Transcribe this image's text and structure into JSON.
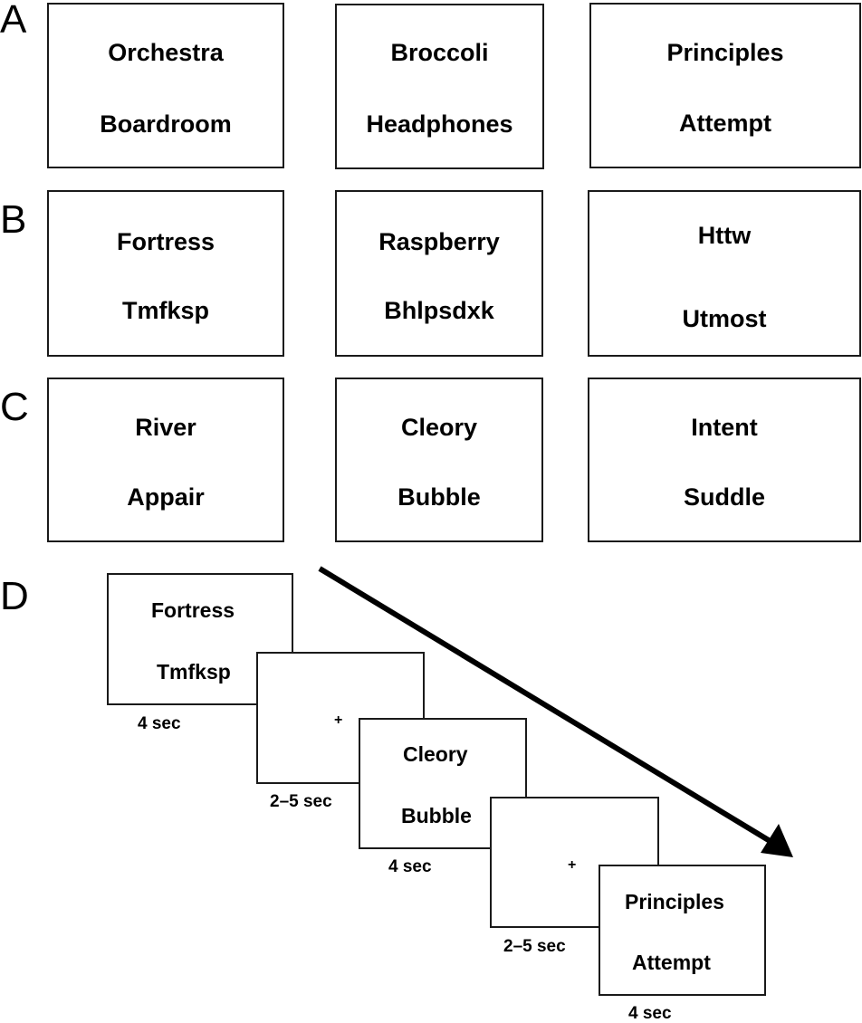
{
  "panels": {
    "A": {
      "letter": "A",
      "stimuli": [
        {
          "top": "Orchestra",
          "bottom": "Boardroom"
        },
        {
          "top": "Broccoli",
          "bottom": "Headphones"
        },
        {
          "top": "Principles",
          "bottom": "Attempt"
        }
      ]
    },
    "B": {
      "letter": "B",
      "stimuli": [
        {
          "top": "Fortress",
          "bottom": "Tmfksp"
        },
        {
          "top": "Raspberry",
          "bottom": "Bhlpsdxk"
        },
        {
          "top": "Httw",
          "bottom": "Utmost"
        }
      ]
    },
    "C": {
      "letter": "C",
      "stimuli": [
        {
          "top": "River",
          "bottom": "Appair"
        },
        {
          "top": "Cleory",
          "bottom": "Bubble"
        },
        {
          "top": "Intent",
          "bottom": "Suddle"
        }
      ]
    },
    "D": {
      "letter": "D",
      "sequence": [
        {
          "type": "stimulus",
          "top": "Fortress",
          "bottom": "Tmfksp",
          "duration": "4 sec"
        },
        {
          "type": "fixation",
          "symbol": "+",
          "duration": "2–5 sec"
        },
        {
          "type": "stimulus",
          "top": "Cleory",
          "bottom": "Bubble",
          "duration": "4 sec"
        },
        {
          "type": "fixation",
          "symbol": "+",
          "duration": "2–5 sec"
        },
        {
          "type": "stimulus",
          "top": "Principles",
          "bottom": "Attempt",
          "duration": "4 sec"
        }
      ],
      "arrow_meaning": "time"
    }
  }
}
